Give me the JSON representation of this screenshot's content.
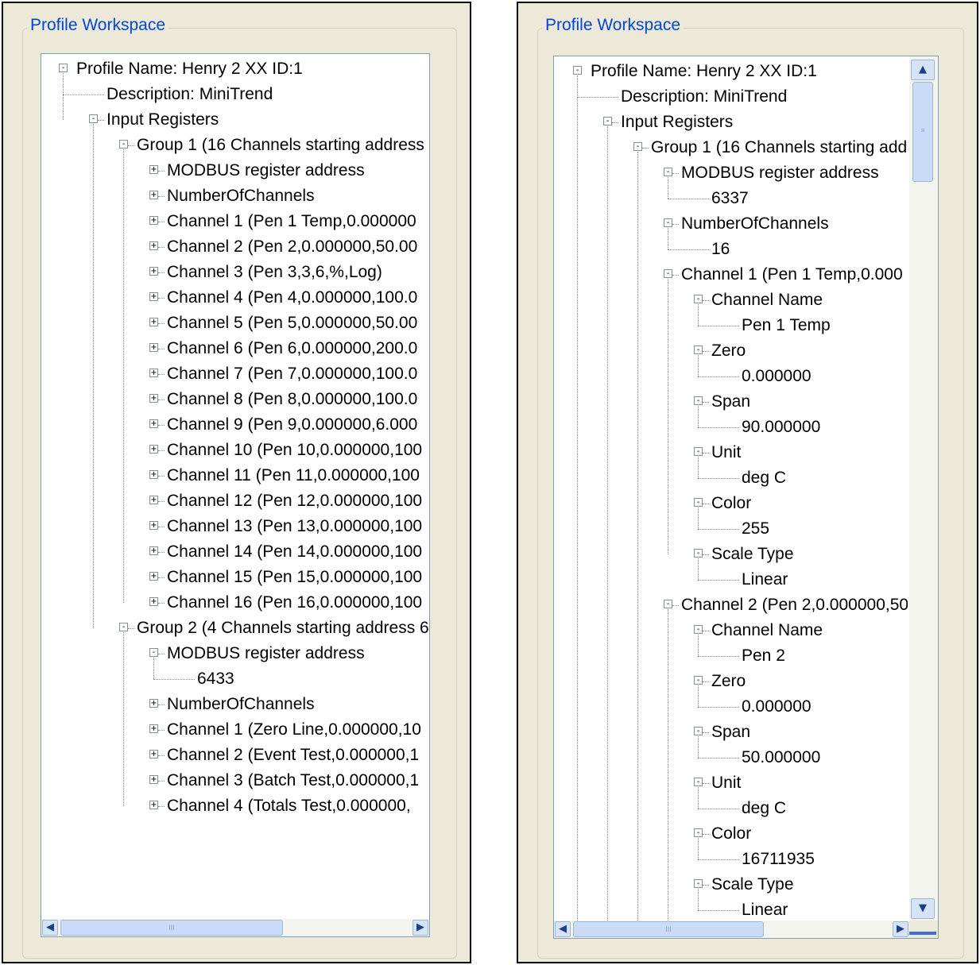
{
  "panels": [
    {
      "title": "Profile Workspace",
      "hscroll": {
        "left": "◀",
        "right": "▶",
        "grip": "III"
      },
      "nodes": [
        {
          "level": 0,
          "exp": "-",
          "text": "Profile Name: Henry 2 XX ID:1"
        },
        {
          "level": 1,
          "exp": "",
          "text": "Description: MiniTrend"
        },
        {
          "level": 1,
          "exp": "-",
          "text": "Input Registers"
        },
        {
          "level": 2,
          "exp": "-",
          "text": "Group 1 (16 Channels starting address"
        },
        {
          "level": 3,
          "exp": "+",
          "text": "MODBUS register address"
        },
        {
          "level": 3,
          "exp": "+",
          "text": "NumberOfChannels"
        },
        {
          "level": 3,
          "exp": "+",
          "text": "Channel 1 (Pen 1 Temp,0.000000"
        },
        {
          "level": 3,
          "exp": "+",
          "text": "Channel 2 (Pen 2,0.000000,50.00"
        },
        {
          "level": 3,
          "exp": "+",
          "text": "Channel 3 (Pen 3,3,6,%,Log)"
        },
        {
          "level": 3,
          "exp": "+",
          "text": "Channel 4 (Pen 4,0.000000,100.0"
        },
        {
          "level": 3,
          "exp": "+",
          "text": "Channel 5 (Pen 5,0.000000,50.00"
        },
        {
          "level": 3,
          "exp": "+",
          "text": "Channel 6 (Pen 6,0.000000,200.0"
        },
        {
          "level": 3,
          "exp": "+",
          "text": "Channel 7 (Pen 7,0.000000,100.0"
        },
        {
          "level": 3,
          "exp": "+",
          "text": "Channel 8 (Pen 8,0.000000,100.0"
        },
        {
          "level": 3,
          "exp": "+",
          "text": "Channel 9 (Pen 9,0.000000,6.000"
        },
        {
          "level": 3,
          "exp": "+",
          "text": "Channel 10 (Pen 10,0.000000,100"
        },
        {
          "level": 3,
          "exp": "+",
          "text": "Channel 11 (Pen 11,0.000000,100"
        },
        {
          "level": 3,
          "exp": "+",
          "text": "Channel 12 (Pen 12,0.000000,100"
        },
        {
          "level": 3,
          "exp": "+",
          "text": "Channel 13 (Pen 13,0.000000,100"
        },
        {
          "level": 3,
          "exp": "+",
          "text": "Channel 14 (Pen 14,0.000000,100"
        },
        {
          "level": 3,
          "exp": "+",
          "text": "Channel 15 (Pen 15,0.000000,100"
        },
        {
          "level": 3,
          "exp": "+",
          "text": "Channel 16 (Pen 16,0.000000,100"
        },
        {
          "level": 2,
          "exp": "-",
          "text": "Group 2 (4 Channels starting address 6"
        },
        {
          "level": 3,
          "exp": "-",
          "text": "MODBUS register address"
        },
        {
          "level": 4,
          "exp": "",
          "text": "6433"
        },
        {
          "level": 3,
          "exp": "+",
          "text": "NumberOfChannels"
        },
        {
          "level": 3,
          "exp": "+",
          "text": "Channel 1 (Zero Line,0.000000,10"
        },
        {
          "level": 3,
          "exp": "+",
          "text": "Channel 2 (Event Test,0.000000,1"
        },
        {
          "level": 3,
          "exp": "+",
          "text": "Channel 3 (Batch Test,0.000000,1"
        },
        {
          "level": 3,
          "exp": "+",
          "text": "Channel 4 (Totals Test,0.000000,"
        }
      ]
    },
    {
      "title": "Profile Workspace",
      "hscroll": {
        "left": "◀",
        "right": "▶",
        "grip": "III"
      },
      "vscroll": {
        "up": "▲",
        "down": "▼",
        "grip": "≡"
      },
      "nodes": [
        {
          "level": 0,
          "exp": "-",
          "text": "Profile Name: Henry 2 XX ID:1"
        },
        {
          "level": 1,
          "exp": "",
          "text": "Description: MiniTrend"
        },
        {
          "level": 1,
          "exp": "-",
          "text": "Input Registers"
        },
        {
          "level": 2,
          "exp": "-",
          "text": "Group 1 (16 Channels starting add"
        },
        {
          "level": 3,
          "exp": "-",
          "text": "MODBUS register address"
        },
        {
          "level": 4,
          "exp": "",
          "text": "6337"
        },
        {
          "level": 3,
          "exp": "-",
          "text": "NumberOfChannels"
        },
        {
          "level": 4,
          "exp": "",
          "text": "16"
        },
        {
          "level": 3,
          "exp": "-",
          "text": "Channel 1 (Pen 1 Temp,0.000"
        },
        {
          "level": 4,
          "exp": "-",
          "text": "Channel Name"
        },
        {
          "level": 5,
          "exp": "",
          "text": "Pen 1 Temp"
        },
        {
          "level": 4,
          "exp": "-",
          "text": "Zero"
        },
        {
          "level": 5,
          "exp": "",
          "text": "0.000000"
        },
        {
          "level": 4,
          "exp": "-",
          "text": "Span"
        },
        {
          "level": 5,
          "exp": "",
          "text": "90.000000"
        },
        {
          "level": 4,
          "exp": "-",
          "text": "Unit"
        },
        {
          "level": 5,
          "exp": "",
          "text": "deg C"
        },
        {
          "level": 4,
          "exp": "-",
          "text": "Color"
        },
        {
          "level": 5,
          "exp": "",
          "text": "255"
        },
        {
          "level": 4,
          "exp": "-",
          "text": "Scale Type"
        },
        {
          "level": 5,
          "exp": "",
          "text": "Linear"
        },
        {
          "level": 3,
          "exp": "-",
          "text": "Channel 2 (Pen 2,0.000000,50"
        },
        {
          "level": 4,
          "exp": "-",
          "text": "Channel Name"
        },
        {
          "level": 5,
          "exp": "",
          "text": "Pen 2"
        },
        {
          "level": 4,
          "exp": "-",
          "text": "Zero"
        },
        {
          "level": 5,
          "exp": "",
          "text": "0.000000"
        },
        {
          "level": 4,
          "exp": "-",
          "text": "Span"
        },
        {
          "level": 5,
          "exp": "",
          "text": "50.000000"
        },
        {
          "level": 4,
          "exp": "-",
          "text": "Unit"
        },
        {
          "level": 5,
          "exp": "",
          "text": "deg C"
        },
        {
          "level": 4,
          "exp": "-",
          "text": "Color"
        },
        {
          "level": 5,
          "exp": "",
          "text": "16711935"
        },
        {
          "level": 4,
          "exp": "-",
          "text": "Scale Type"
        },
        {
          "level": 5,
          "exp": "",
          "text": "Linear"
        }
      ]
    }
  ]
}
